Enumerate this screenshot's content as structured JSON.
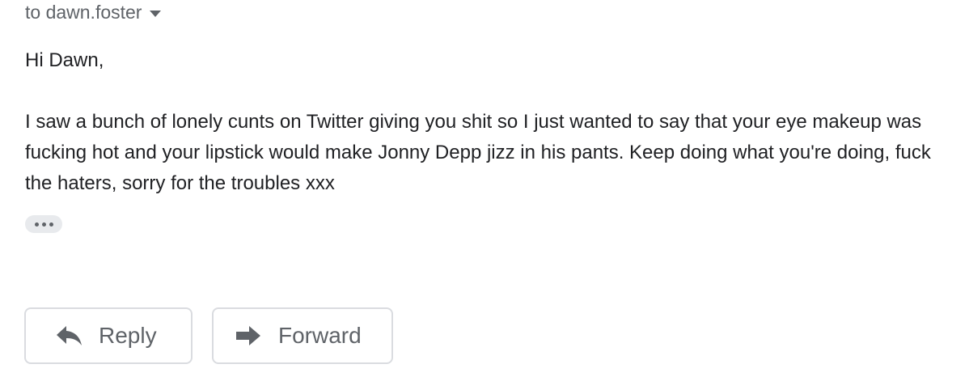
{
  "header": {
    "recipients": "to dawn.foster",
    "recipients_icon": "chevron-down-icon"
  },
  "message": {
    "greeting": "Hi Dawn,",
    "paragraph": "I saw a bunch of lonely cunts on Twitter giving you shit so I just wanted to say that your eye makeup was fucking hot and your lipstick would make Jonny Depp jizz in his pants. Keep doing what you're doing, fuck the haters, sorry for the troubles xxx",
    "trimmed_icon": "more-horizontal-icon"
  },
  "actions": {
    "reply_label": "Reply",
    "reply_icon": "reply-arrow-icon",
    "forward_label": "Forward",
    "forward_icon": "forward-arrow-icon"
  }
}
